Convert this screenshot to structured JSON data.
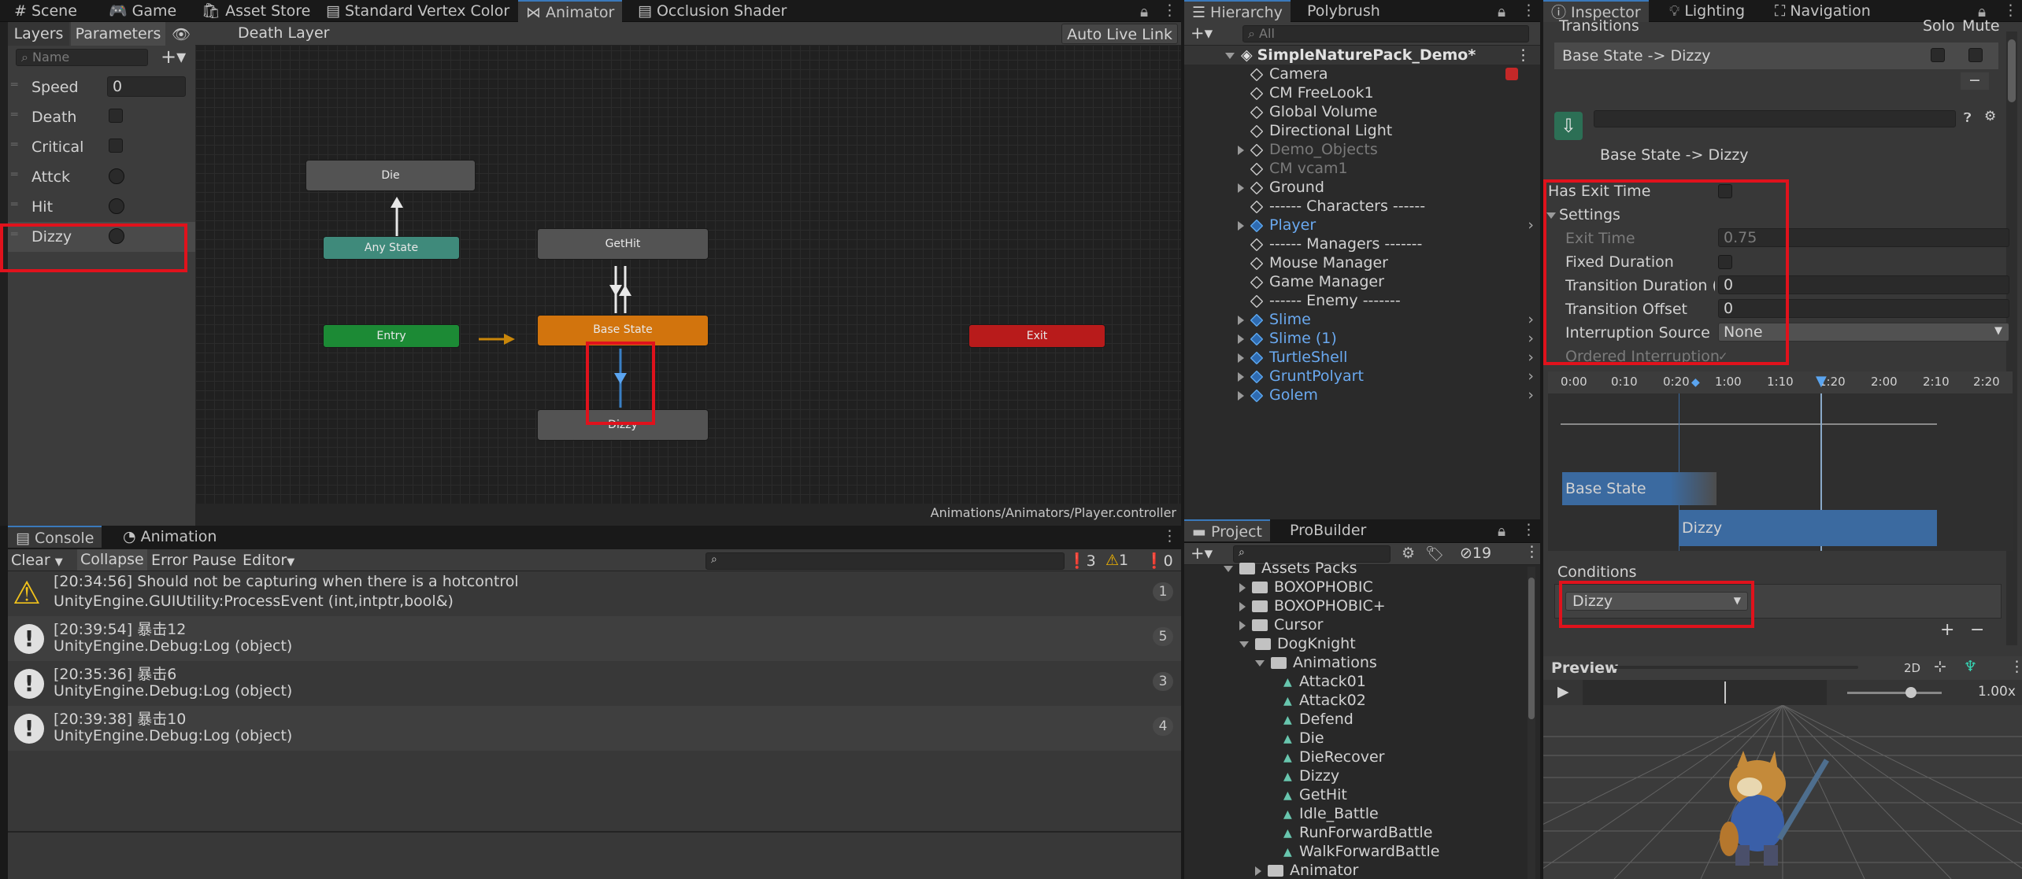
{
  "tabs_left": [
    {
      "label": "# Scene"
    },
    {
      "label": "Game"
    },
    {
      "label": "Asset Store"
    },
    {
      "label": "Standard Vertex Color"
    },
    {
      "label": "Animator"
    },
    {
      "label": "Occlusion Shader"
    }
  ],
  "animator": {
    "layers_tab": "Layers",
    "parameters_tab": "Parameters",
    "layer_name": "Death Layer",
    "auto_live_link": "Auto Live Link",
    "name_placeholder": "Name",
    "parameters": [
      {
        "name": "Speed",
        "type": "float",
        "value": "0"
      },
      {
        "name": "Death",
        "type": "bool"
      },
      {
        "name": "Critical",
        "type": "bool"
      },
      {
        "name": "Attck",
        "type": "trigger"
      },
      {
        "name": "Hit",
        "type": "trigger"
      },
      {
        "name": "Dizzy",
        "type": "trigger"
      }
    ],
    "states": {
      "die": "Die",
      "any_state": "Any State",
      "gethit": "GetHit",
      "entry": "Entry",
      "base_state": "Base State",
      "exit": "Exit",
      "dizzy": "Dizzy"
    },
    "footer_path": "Animations/Animators/Player.controller"
  },
  "console": {
    "tab_console": "Console",
    "tab_animation": "Animation",
    "clear": "Clear",
    "collapse": "Collapse",
    "error_pause": "Error Pause",
    "editor": "Editor",
    "count_messages": "3",
    "count_warnings": "1",
    "count_errors": "0",
    "logs": [
      {
        "type": "warning",
        "line1": "[20:34:56] Should not be capturing when there is a hotcontrol",
        "line2": "UnityEngine.GUIUtility:ProcessEvent (int,intptr,bool&)",
        "count": "1"
      },
      {
        "type": "info",
        "line1": "[20:39:54] 暴击12",
        "line2": "UnityEngine.Debug:Log (object)",
        "count": "5"
      },
      {
        "type": "info",
        "line1": "[20:35:36] 暴击6",
        "line2": "UnityEngine.Debug:Log (object)",
        "count": "3"
      },
      {
        "type": "info",
        "line1": "[20:39:38] 暴击10",
        "line2": "UnityEngine.Debug:Log (object)",
        "count": "4"
      }
    ]
  },
  "hierarchy": {
    "tab": "Hierarchy",
    "tab2": "Polybrush",
    "search_placeholder": "All",
    "scene": "SimpleNaturePack_Demo*",
    "items": [
      {
        "label": "Camera",
        "indent": 1,
        "style": "normal",
        "fold": "none"
      },
      {
        "label": "CM FreeLook1",
        "indent": 1,
        "style": "normal",
        "fold": "none"
      },
      {
        "label": "Global Volume",
        "indent": 1,
        "style": "normal",
        "fold": "none"
      },
      {
        "label": "Directional Light",
        "indent": 1,
        "style": "normal",
        "fold": "none"
      },
      {
        "label": "Demo_Objects",
        "indent": 1,
        "style": "dim",
        "fold": "closed"
      },
      {
        "label": "CM vcam1",
        "indent": 1,
        "style": "dim",
        "fold": "none"
      },
      {
        "label": "Ground",
        "indent": 1,
        "style": "normal",
        "fold": "closed"
      },
      {
        "label": "------ Characters ------",
        "indent": 1,
        "style": "normal",
        "fold": "none"
      },
      {
        "label": "Player",
        "indent": 1,
        "style": "prefab",
        "fold": "closed"
      },
      {
        "label": "------ Managers -------",
        "indent": 1,
        "style": "normal",
        "fold": "none"
      },
      {
        "label": "Mouse Manager",
        "indent": 1,
        "style": "normal",
        "fold": "none"
      },
      {
        "label": "Game Manager",
        "indent": 1,
        "style": "normal",
        "fold": "none"
      },
      {
        "label": "------ Enemy -------",
        "indent": 1,
        "style": "normal",
        "fold": "none"
      },
      {
        "label": "Slime",
        "indent": 1,
        "style": "prefab",
        "fold": "closed"
      },
      {
        "label": "Slime (1)",
        "indent": 1,
        "style": "prefab",
        "fold": "closed"
      },
      {
        "label": "TurtleShell",
        "indent": 1,
        "style": "prefab",
        "fold": "closed"
      },
      {
        "label": "GruntPolyart",
        "indent": 1,
        "style": "prefab",
        "fold": "closed"
      },
      {
        "label": "Golem",
        "indent": 1,
        "style": "prefab",
        "fold": "closed"
      }
    ]
  },
  "project": {
    "tab": "Project",
    "tab2": "ProBuilder",
    "hidden_count": "19",
    "items": [
      {
        "label": "Assets Packs",
        "indent": 0,
        "kind": "folder",
        "fold": "open"
      },
      {
        "label": "BOXOPHOBIC",
        "indent": 1,
        "kind": "folder",
        "fold": "closed"
      },
      {
        "label": "BOXOPHOBIC+",
        "indent": 1,
        "kind": "folder",
        "fold": "closed"
      },
      {
        "label": "Cursor",
        "indent": 1,
        "kind": "folder",
        "fold": "closed"
      },
      {
        "label": "DogKnight",
        "indent": 1,
        "kind": "folder",
        "fold": "open"
      },
      {
        "label": "Animations",
        "indent": 2,
        "kind": "folder",
        "fold": "open"
      },
      {
        "label": "Attack01",
        "indent": 3,
        "kind": "anim",
        "fold": "none"
      },
      {
        "label": "Attack02",
        "indent": 3,
        "kind": "anim",
        "fold": "none"
      },
      {
        "label": "Defend",
        "indent": 3,
        "kind": "anim",
        "fold": "none"
      },
      {
        "label": "Die",
        "indent": 3,
        "kind": "anim",
        "fold": "none"
      },
      {
        "label": "DieRecover",
        "indent": 3,
        "kind": "anim",
        "fold": "none"
      },
      {
        "label": "Dizzy",
        "indent": 3,
        "kind": "anim",
        "fold": "none"
      },
      {
        "label": "GetHit",
        "indent": 3,
        "kind": "anim",
        "fold": "none"
      },
      {
        "label": "Idle_Battle",
        "indent": 3,
        "kind": "anim",
        "fold": "none"
      },
      {
        "label": "RunForwardBattle",
        "indent": 3,
        "kind": "anim",
        "fold": "none"
      },
      {
        "label": "WalkForwardBattle",
        "indent": 3,
        "kind": "anim",
        "fold": "none"
      },
      {
        "label": "Animator",
        "indent": 2,
        "kind": "folder",
        "fold": "closed"
      }
    ]
  },
  "inspector": {
    "tab": "Inspector",
    "tab2": "Lighting",
    "tab3": "Navigation",
    "transitions_header": "Transitions",
    "solo": "Solo",
    "mute": "Mute",
    "transition_item": "Base State -> Dizzy",
    "transition_title": "Base State -> Dizzy",
    "has_exit_time": "Has Exit Time",
    "settings": "Settings",
    "exit_time_label": "Exit Time",
    "exit_time_value": "0.75",
    "fixed_duration": "Fixed Duration",
    "transition_duration_label": "Transition Duration (%",
    "transition_duration_value": "0",
    "transition_offset_label": "Transition Offset",
    "transition_offset_value": "0",
    "interruption_source_label": "Interruption Source",
    "interruption_source_value": "None",
    "ordered_interruption": "Ordered Interruption",
    "timeline_ticks": [
      "0:00",
      "0:10",
      "0:20",
      "1:00",
      "1:10",
      "1:20",
      "2:00",
      "2:10",
      "2:20"
    ],
    "timeline_base": "Base State",
    "timeline_dizzy": "Dizzy",
    "conditions": "Conditions",
    "condition_value": "Dizzy",
    "preview": "Preview",
    "preview_2d": "2D",
    "preview_speed": "1.00x"
  }
}
